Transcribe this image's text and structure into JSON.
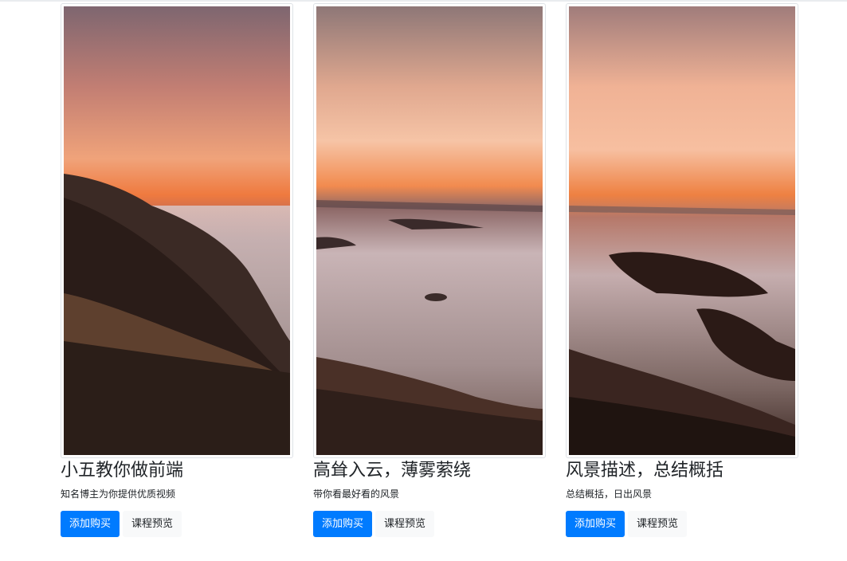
{
  "colors": {
    "primary": "#007bff",
    "light": "#f8f9fa",
    "text": "#212529"
  },
  "cards": [
    {
      "title": "小五教你做前端",
      "description": "知名博主为你提供优质视频",
      "buy_label": "添加购买",
      "preview_label": "课程预览"
    },
    {
      "title": "高耸入云，薄雾萦绕",
      "description": "带你看最好看的风景",
      "buy_label": "添加购买",
      "preview_label": "课程预览"
    },
    {
      "title": "风景描述，总结概括",
      "description": "总结概括，日出风景",
      "buy_label": "添加购买",
      "preview_label": "课程预览"
    }
  ]
}
